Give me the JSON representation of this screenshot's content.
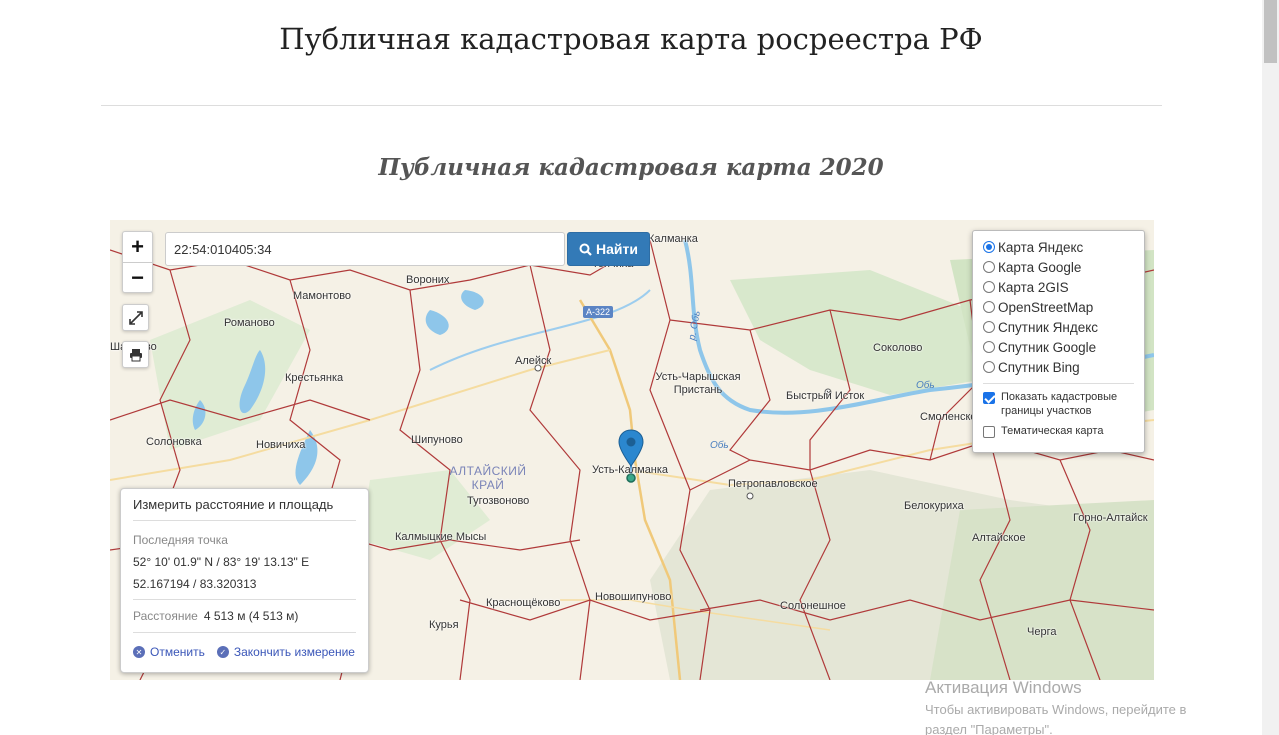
{
  "header": {
    "title": "Публичная кадастровая карта росреестра РФ",
    "subtitle": "Публичная кадастровая карта 2020"
  },
  "search": {
    "value": "22:54:010405:34",
    "button_label": "Найти"
  },
  "map_controls": {
    "zoom_in": "+",
    "zoom_out": "−"
  },
  "layers": {
    "base_maps": [
      {
        "label": "Карта Яндекс",
        "selected": true
      },
      {
        "label": "Карта Google",
        "selected": false
      },
      {
        "label": "Карта 2GIS",
        "selected": false
      },
      {
        "label": "OpenStreetMap",
        "selected": false
      },
      {
        "label": "Спутник Яндекс",
        "selected": false
      },
      {
        "label": "Спутник Google",
        "selected": false
      },
      {
        "label": "Спутник Bing",
        "selected": false
      }
    ],
    "overlays": [
      {
        "label": "Показать кадастровые границы участков",
        "checked": true
      },
      {
        "label": "Тематическая карта",
        "checked": false
      }
    ]
  },
  "measure": {
    "title": "Измерить расстояние и площадь",
    "last_point_label": "Последняя точка",
    "coords_dms": "52° 10' 01.9\" N / 83° 19' 13.13\" E",
    "coords_decimal": "52.167194 / 83.320313",
    "distance_label": "Расстояние",
    "distance_value": "4 513 м (4 513 м)",
    "cancel_label": "Отменить",
    "finish_label": "Закончить измерение"
  },
  "map": {
    "region_label": "АЛТАЙСКИЙ\nКРАЙ",
    "road_shield": "А-322",
    "river_labels": [
      "р. Обь",
      "Обь",
      "Обь"
    ],
    "places": [
      "Калманка",
      "Топчиха",
      "Вороних",
      "Мамонтово",
      "Романово",
      "Шадрово",
      "Алейск",
      "Крестьянка",
      "Усть-Чарышская Пристань",
      "Соколово",
      "Быстрый Исток",
      "Смоленское",
      "Солоновка",
      "Новичиха",
      "Шипуново",
      "Усть-Калманка",
      "Петропавловское",
      "Тугозвоново",
      "Белокуриха",
      "Калмыцкие Мысы",
      "Горно-Алтайск",
      "Алтайское",
      "Новошипуново",
      "Краснощёково",
      "Солонешное",
      "Курья",
      "Черга"
    ]
  },
  "colors": {
    "accent": "#337ab7",
    "boundary": "#b03a3a",
    "water": "#8ec6ea",
    "forest": "#cfe3c0",
    "land": "#f5f1e6",
    "marker": "#2b87cf"
  },
  "watermark": {
    "title": "Активация Windows",
    "line1": "Чтобы активировать Windows, перейдите в",
    "line2": "раздел \"Параметры\"."
  }
}
